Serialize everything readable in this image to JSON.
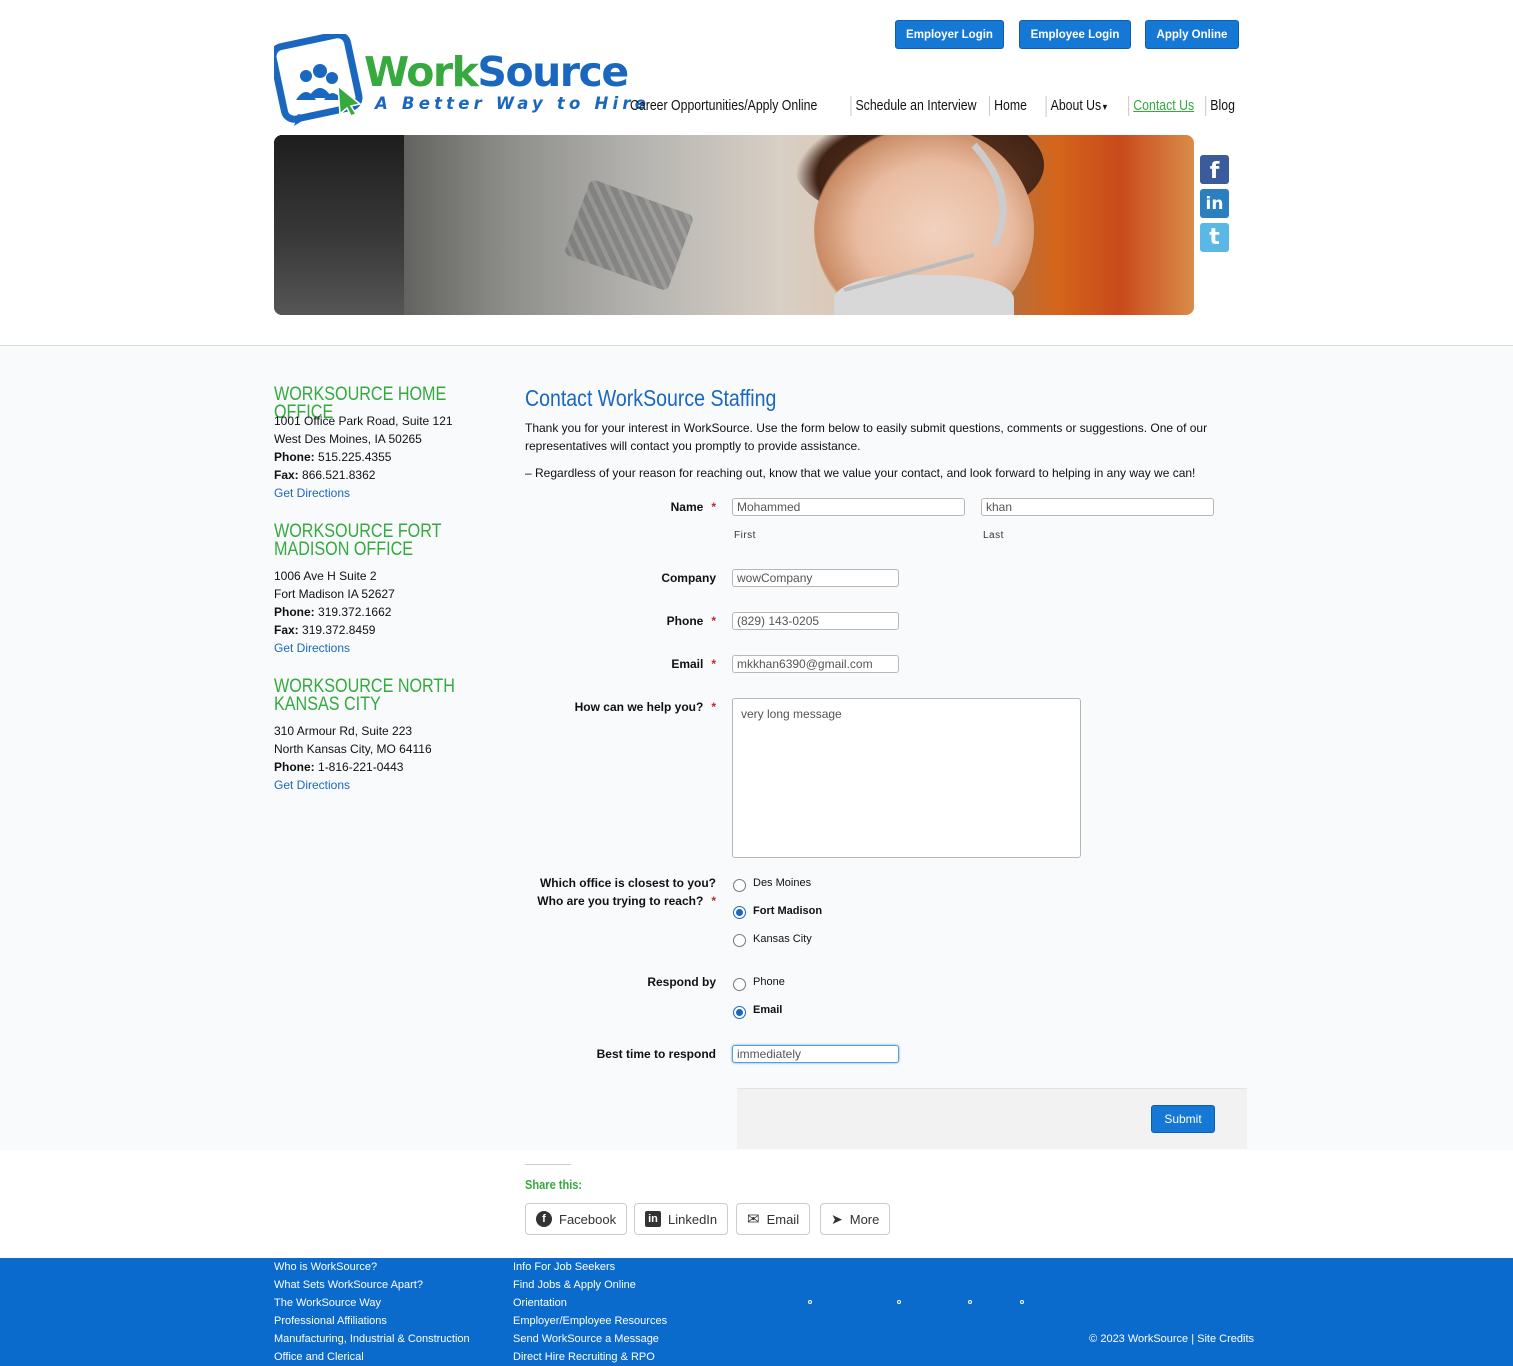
{
  "header": {
    "buttons": [
      "Employer Login",
      "Employee Login",
      "Apply Online"
    ],
    "logo_word_a": "Work",
    "logo_word_b": "Source",
    "logo_tagline": "A Better Way to Hire",
    "nav": [
      "Career Opportunities/Apply Online",
      "Schedule an Interview",
      "Home",
      "About Us",
      "Contact Us",
      "Blog"
    ],
    "active_nav": "Contact Us"
  },
  "social": [
    "facebook",
    "linkedin",
    "twitter"
  ],
  "offices": [
    {
      "title": "WORKSOURCE HOME OFFICE",
      "line1": "1001 Office Park Road, Suite 121",
      "line2": "West Des Moines, IA 50265",
      "phone_label": "Phone:",
      "phone": "515.225.4355",
      "fax_label": "Fax:",
      "fax": "866.521.8362",
      "link": "Get Directions"
    },
    {
      "title": "WORKSOURCE FORT MADISON OFFICE",
      "line1": "1006 Ave H Suite 2",
      "line2": "Fort Madison IA 52627",
      "phone_label": "Phone:",
      "phone": "319.372.1662",
      "fax_label": "Fax:",
      "fax": "319.372.8459",
      "link": "Get Directions"
    },
    {
      "title": "WORKSOURCE NORTH KANSAS CITY",
      "line1": "310 Armour Rd, Suite 223",
      "line2": "North Kansas City, MO 64116",
      "phone_label": "Phone:",
      "phone": "1-816-221-0443",
      "link": "Get Directions"
    }
  ],
  "contact": {
    "title": "Contact WorkSource Staffing",
    "intro": "Thank you for your interest in WorkSource. Use the form below to easily submit questions, comments or suggestions. One of our representatives will contact you promptly to provide assistance.",
    "note": "– Regardless of your reason for reaching out, know that we value your contact, and look forward to helping in any way we can!"
  },
  "form": {
    "name_label": "Name",
    "first_value": "Mohammed",
    "last_value": "khan",
    "first_sub": "First",
    "last_sub": "Last",
    "company_label": "Company",
    "company_value": "wowCompany",
    "phone_label": "Phone",
    "phone_value": "(829) 143-0205",
    "email_label": "Email",
    "email_value": "mkkhan6390@gmail.com",
    "help_label": "How can we help you?",
    "help_value": "very long message",
    "office_label_1": "Which office is closest to you?",
    "office_label_2": "Who are you trying to reach?",
    "office_options": [
      "Des Moines",
      "Fort Madison",
      "Kansas City"
    ],
    "office_selected": "Fort Madison",
    "respond_label": "Respond by",
    "respond_options": [
      "Phone",
      "Email"
    ],
    "respond_selected": "Email",
    "time_label": "Best time to respond",
    "time_value": "immediately",
    "submit": "Submit",
    "required_mark": "*"
  },
  "share": {
    "title": "Share this:",
    "buttons": [
      "Facebook",
      "LinkedIn",
      "Email",
      "More"
    ]
  },
  "footer": {
    "col1": [
      "Who is WorkSource?",
      "What Sets WorkSource Apart?",
      "The WorkSource Way",
      "Professional Affiliations",
      "Manufacturing, Industrial & Construction",
      "Office and Clerical"
    ],
    "col2": [
      "Info For Job Seekers",
      "Find Jobs & Apply Online",
      "Orientation",
      "Employer/Employee Resources",
      "Send WorkSource a Message",
      "Direct Hire Recruiting & RPO"
    ],
    "copyright": "© 2023 WorkSource | Site Credits"
  },
  "colors": {
    "brand_blue": "#1a67bf",
    "brand_green": "#36a93f",
    "footer_blue": "#0a6bcc",
    "required_red": "#c0282e"
  }
}
